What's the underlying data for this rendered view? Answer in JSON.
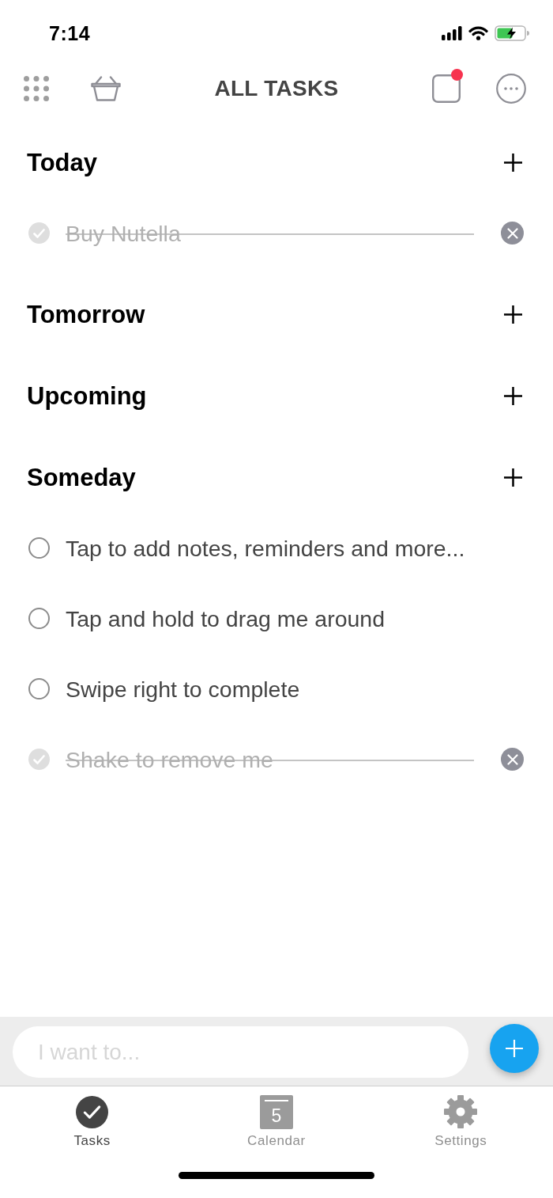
{
  "status_bar": {
    "time": "7:14"
  },
  "header": {
    "title": "ALL TASKS",
    "has_notification": true
  },
  "sections": [
    {
      "title": "Today",
      "tasks": [
        {
          "text": "Buy Nutella",
          "done": true
        }
      ]
    },
    {
      "title": "Tomorrow"
    },
    {
      "title": "Upcoming"
    },
    {
      "title": "Someday",
      "tasks": [
        {
          "text": "Tap to add notes, reminders and more...",
          "done": false
        },
        {
          "text": "Tap and hold to drag me around",
          "done": false
        },
        {
          "text": "Swipe right to complete",
          "done": false
        },
        {
          "text": "Shake to remove me",
          "done": true
        }
      ]
    }
  ],
  "composer": {
    "placeholder": "I want to..."
  },
  "tab_bar": [
    {
      "kind": "tasks",
      "label": "Tasks",
      "selected": true
    },
    {
      "kind": "calendar",
      "label": "Calendar",
      "icon_text": "5",
      "selected": false
    },
    {
      "kind": "settings",
      "label": "Settings",
      "selected": false
    }
  ]
}
